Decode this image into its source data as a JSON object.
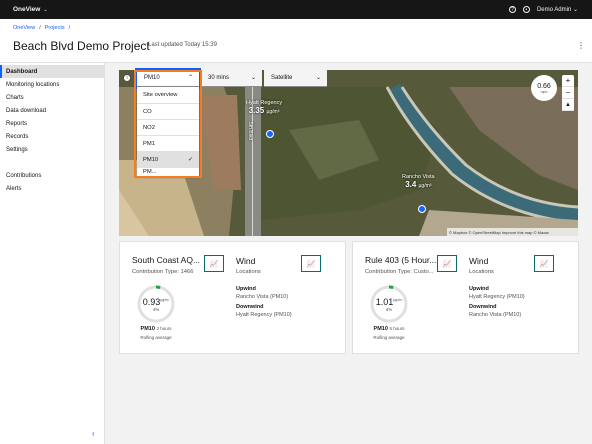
{
  "app": {
    "name": "OneView",
    "user": "Demo Admin"
  },
  "breadcrumb": [
    "OneView",
    "Projects"
  ],
  "page": {
    "title": "Beach Blvd Demo Project",
    "last_updated": "Last updated Today 15:39"
  },
  "sidebar": {
    "items": [
      {
        "label": "Dashboard",
        "active": true
      },
      {
        "label": "Monitoring locations"
      },
      {
        "label": "Charts"
      },
      {
        "label": "Data download"
      },
      {
        "label": "Reports"
      },
      {
        "label": "Records"
      },
      {
        "label": "Settings"
      }
    ],
    "items2": [
      {
        "label": "Contributions"
      },
      {
        "label": "Alerts"
      }
    ]
  },
  "map": {
    "pollutant": "PM10",
    "interval": "30 mins",
    "view": "Satellite",
    "dropdown": [
      "Site overview",
      "CO",
      "NO2",
      "PM1",
      "PM10",
      "PM..."
    ],
    "selected_index": 4,
    "compass_value": "0.66",
    "compass_unit": "mph",
    "street": "5th Blvd",
    "stations": [
      {
        "name": "Hyatt Regency",
        "value": "3.35",
        "unit": "µg/m³"
      },
      {
        "name": "Rancho Vista",
        "value": "3.4",
        "unit": "µg/m³"
      }
    ],
    "attribution": "© Mapbox © OpenStreetMap Improve this map © Maxar"
  },
  "cards": [
    {
      "title": "South Coast AQ...",
      "contribution": "Contribution Type: 1466",
      "gauge_value": "0.93",
      "gauge_unit": "µg/m³",
      "gauge_pct": "4%",
      "gauge_fraction": 0.04,
      "pollutant": "PM10",
      "duration": "2 hours",
      "avg_label": "Rolling average",
      "wind_title": "Wind",
      "wind_sub": "Locations",
      "upwind_label": "Upwind",
      "upwind": "Rancho Vista (PM10)",
      "downwind_label": "Downwind",
      "downwind": "Hyatt Regency (PM10)"
    },
    {
      "title": "Rule 403 (5 Hour...",
      "contribution": "Contribution Type: Custo...",
      "gauge_value": "1.01",
      "gauge_unit": "µg/m³",
      "gauge_pct": "4%",
      "gauge_fraction": 0.04,
      "pollutant": "PM10",
      "duration": "5 hours",
      "avg_label": "Rolling average",
      "wind_title": "Wind",
      "wind_sub": "Locations",
      "upwind_label": "Upwind",
      "upwind": "Hyatt Regency (PM10)",
      "downwind_label": "Downwind",
      "downwind": "Rancho Vista (PM10)"
    }
  ],
  "colors": {
    "accent": "#0f62fe",
    "highlight": "#f57c20",
    "gauge": "#24a148",
    "teal": "#0e6b6b"
  }
}
